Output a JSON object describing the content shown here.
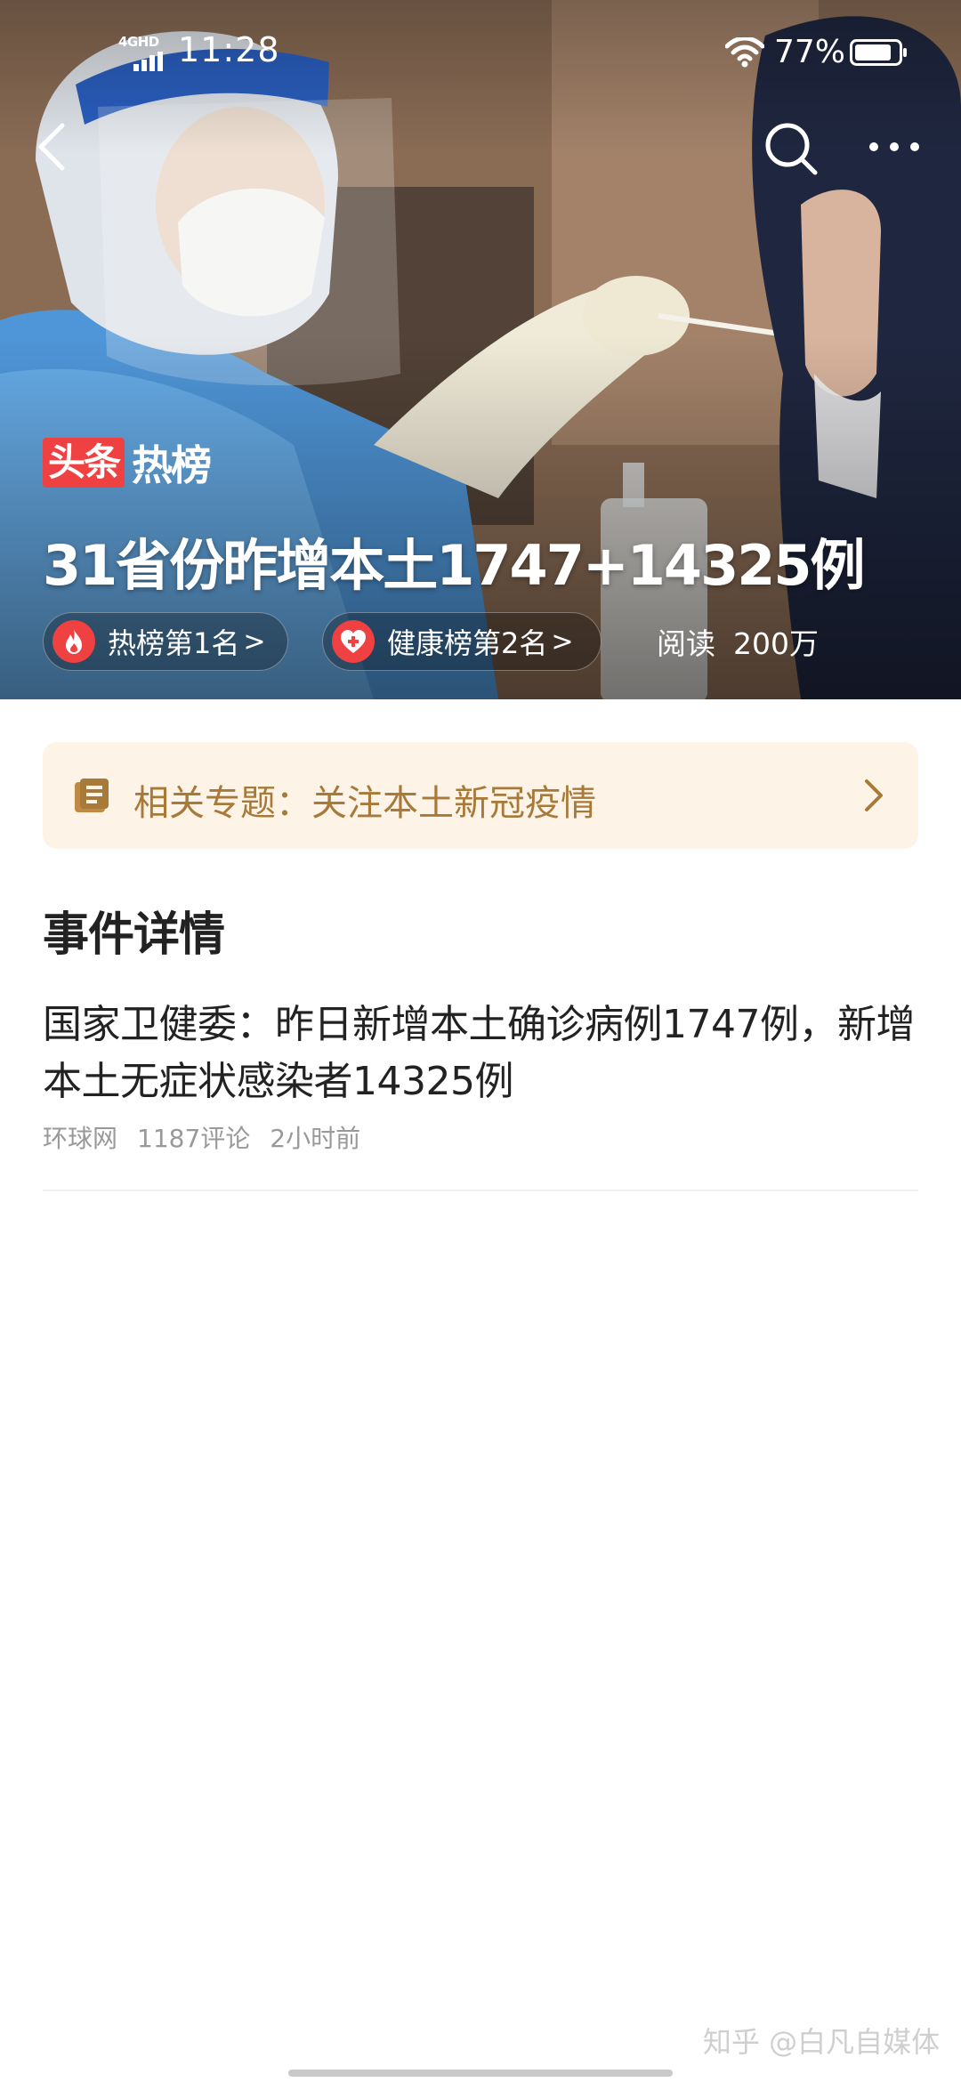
{
  "status_bar": {
    "network": "4GHD",
    "time": "11:28",
    "battery": "77%"
  },
  "hero": {
    "logo_box": "头条",
    "logo_text": "热榜",
    "title": "31省份昨增本土1747+14325例",
    "chips": [
      {
        "label": "热榜第1名",
        "icon": "flame-icon"
      },
      {
        "label": "健康榜第2名",
        "icon": "heart-plus-icon"
      }
    ],
    "chip_arrow": ">",
    "read_label": "阅读",
    "read_count": "200万"
  },
  "topic": {
    "text": "相关专题：关注本土新冠疫情",
    "color": "#a77a3a",
    "background": "#fdf3e6"
  },
  "event": {
    "section_title": "事件详情",
    "headline": "国家卫健委：昨日新增本土确诊病例1747例，新增本土无症状感染者14325例",
    "source": "环球网",
    "comments": "1187评论",
    "time_ago": "2小时前"
  },
  "watermark": "知乎 @白凡自媒体",
  "colors": {
    "accent_red": "#f04142",
    "text_primary": "#222222",
    "text_meta": "#999999"
  }
}
